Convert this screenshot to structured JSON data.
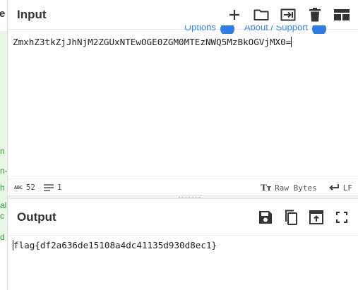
{
  "left_strip": {
    "header_char": "e",
    "fragments": [
      "n",
      "n-",
      "h",
      "al",
      "c",
      "d"
    ]
  },
  "input": {
    "title": "Input",
    "text": "ZmxhZ3tkZjJhNjM2ZGUxNTEwOGE0ZGM0MTEzNWQ5MzBkOGVjMX0=",
    "tools": [
      "add-icon",
      "folder-icon",
      "load-icon",
      "trash-icon",
      "layout-icon"
    ],
    "overlapped_links": {
      "options": "Options",
      "about": "About / Support"
    }
  },
  "status": {
    "length": "52",
    "lines": "1",
    "mode": "Raw Bytes",
    "eol": "LF",
    "length_icon": "abc-icon",
    "lines_icon": "lines-icon",
    "mode_icon": "text-format-icon",
    "eol_icon": "return-icon"
  },
  "output": {
    "title": "Output",
    "text": "flag{df2a636de15108a4dc41135d930d8ec1}",
    "tools": [
      "save-icon",
      "copy-icon",
      "replace-input-icon",
      "fullscreen-icon"
    ]
  },
  "colors": {
    "accent": "#2f7de1",
    "icon": "#333333",
    "green_bg": "#e9f5e7",
    "green_text": "#3b9a3b"
  }
}
